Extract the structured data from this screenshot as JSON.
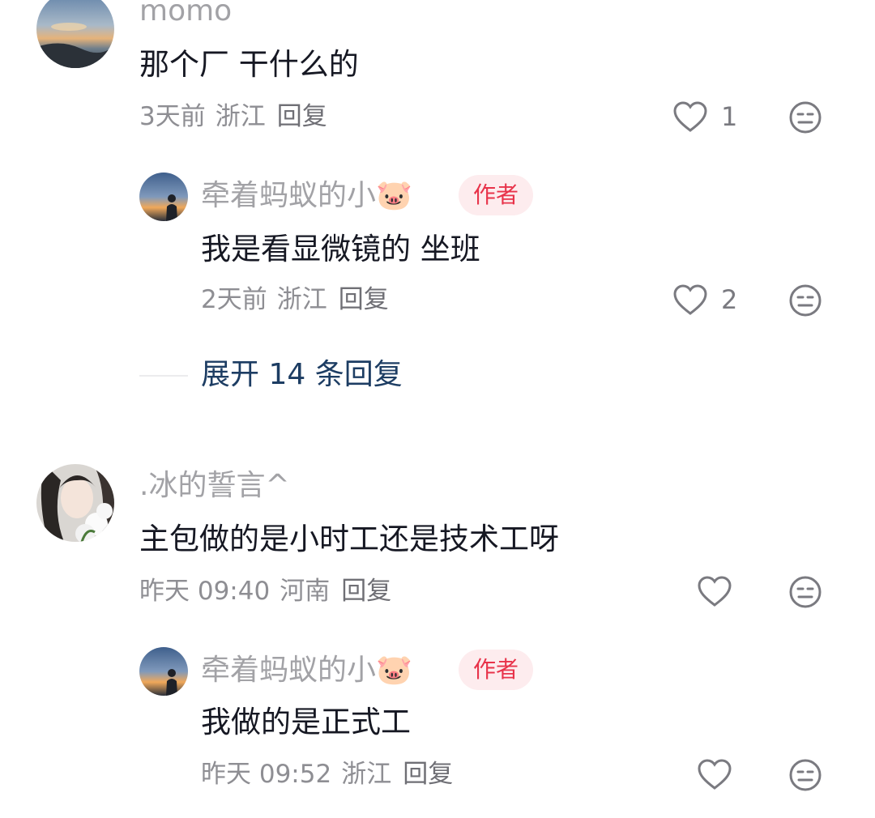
{
  "colors": {
    "name": "#a2a2a6",
    "content": "#161823",
    "meta": "#8e8e93",
    "author_badge_bg": "#fdecee",
    "author_badge_text": "#e8334a",
    "expand_link": "#1d3d63"
  },
  "comments": [
    {
      "username": "momo",
      "text": "那个厂 干什么的",
      "time": "3天前",
      "location": "浙江",
      "reply_label": "回复",
      "likes": "1",
      "avatar": "sunset-sky-avatar",
      "replies": [
        {
          "username": "牵着蚂蚁的小",
          "emoji": "🐷",
          "badge": "作者",
          "text": "我是看显微镜的 坐班",
          "time": "2天前",
          "location": "浙江",
          "reply_label": "回复",
          "likes": "2",
          "avatar": "silhouette-sunset-avatar"
        }
      ],
      "expand_label": "展开 14 条回复"
    },
    {
      "username": ".冰的誓言^",
      "text": "主包做的是小时工还是技术工呀",
      "time": "昨天 09:40",
      "location": "河南",
      "reply_label": "回复",
      "likes": "",
      "avatar": "girl-with-flowers-avatar",
      "replies": [
        {
          "username": "牵着蚂蚁的小",
          "emoji": "🐷",
          "badge": "作者",
          "text": "我做的是正式工",
          "time": "昨天 09:52",
          "location": "浙江",
          "reply_label": "回复",
          "likes": "",
          "avatar": "silhouette-sunset-avatar"
        }
      ]
    }
  ]
}
